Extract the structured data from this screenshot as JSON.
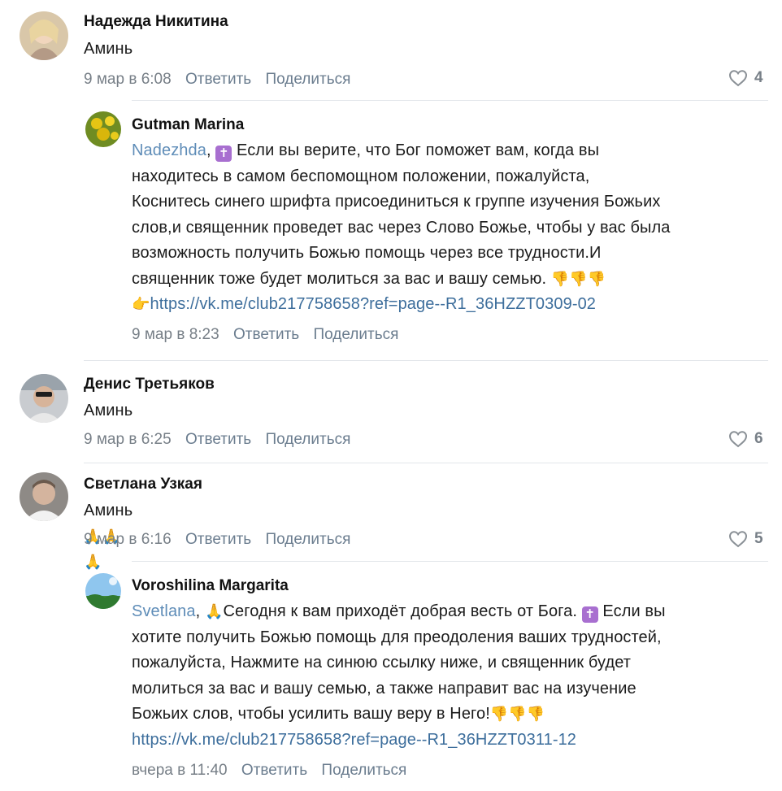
{
  "comments": [
    {
      "author": "Надежда Никитина",
      "text": "Аминь",
      "date": "9 мар в 6:08",
      "reply": "Ответить",
      "share": "Поделиться",
      "likes": "4"
    },
    {
      "author": "Gutman Marina",
      "mention": "Nadezhda",
      "text_lines": [
        "Если вы верите, что Бог поможет вам, когда вы",
        "находитесь в самом беспомощном положении, пожалуйста,",
        "Коснитесь синего шрифта присоединиться к группе изучения Божьих",
        "слов,и священник проведет вас через Слово Божье, чтобы у вас была",
        "возможность получить Божью помощь через все трудности.И",
        "священник тоже будет молиться за вас и вашу семью."
      ],
      "link": "https://vk.me/club217758658?ref=page--R1_36HZZT0309-02",
      "date": "9 мар в 8:23",
      "reply": "Ответить",
      "share": "Поделиться"
    },
    {
      "author": "Денис Третьяков",
      "text": "Аминь",
      "date": "9 мар в 6:25",
      "reply": "Ответить",
      "share": "Поделиться",
      "likes": "6"
    },
    {
      "author": "Светлана Узкая",
      "text": "Аминь",
      "date": "9 мар в 6:16",
      "reply": "Ответить",
      "share": "Поделиться",
      "likes": "5"
    },
    {
      "author": "Voroshilina Margarita",
      "mention": "Svetlana",
      "text_lines": [
        "Сегодня к вам приходёт добрая весть от Бога.",
        "Если вы",
        "хотите получить Божью помощь для преодоления ваших трудностей,",
        "пожалуйста, Нажмите на синюю ссылку ниже, и священник будет",
        "молиться за вас и вашу семью, а также направит вас на изучение",
        "Божьих слов, чтобы усилить вашу веру в Него!"
      ],
      "link": "https://vk.me/club217758658?ref=page--R1_36HZZT0311-12",
      "date": "вчера в 11:40",
      "reply": "Ответить",
      "share": "Поделиться"
    }
  ],
  "icons": {
    "like": "heart-outline-icon",
    "cross": "latin-cross-icon",
    "pray": "folded-hands-icon",
    "point_down": "pointing-down-icon",
    "point_right": "pointing-right-icon"
  },
  "colors": {
    "link": "#3d6e9c",
    "mention": "#5f8db8",
    "meta": "#777f87",
    "separator": "#e3e6ea"
  }
}
